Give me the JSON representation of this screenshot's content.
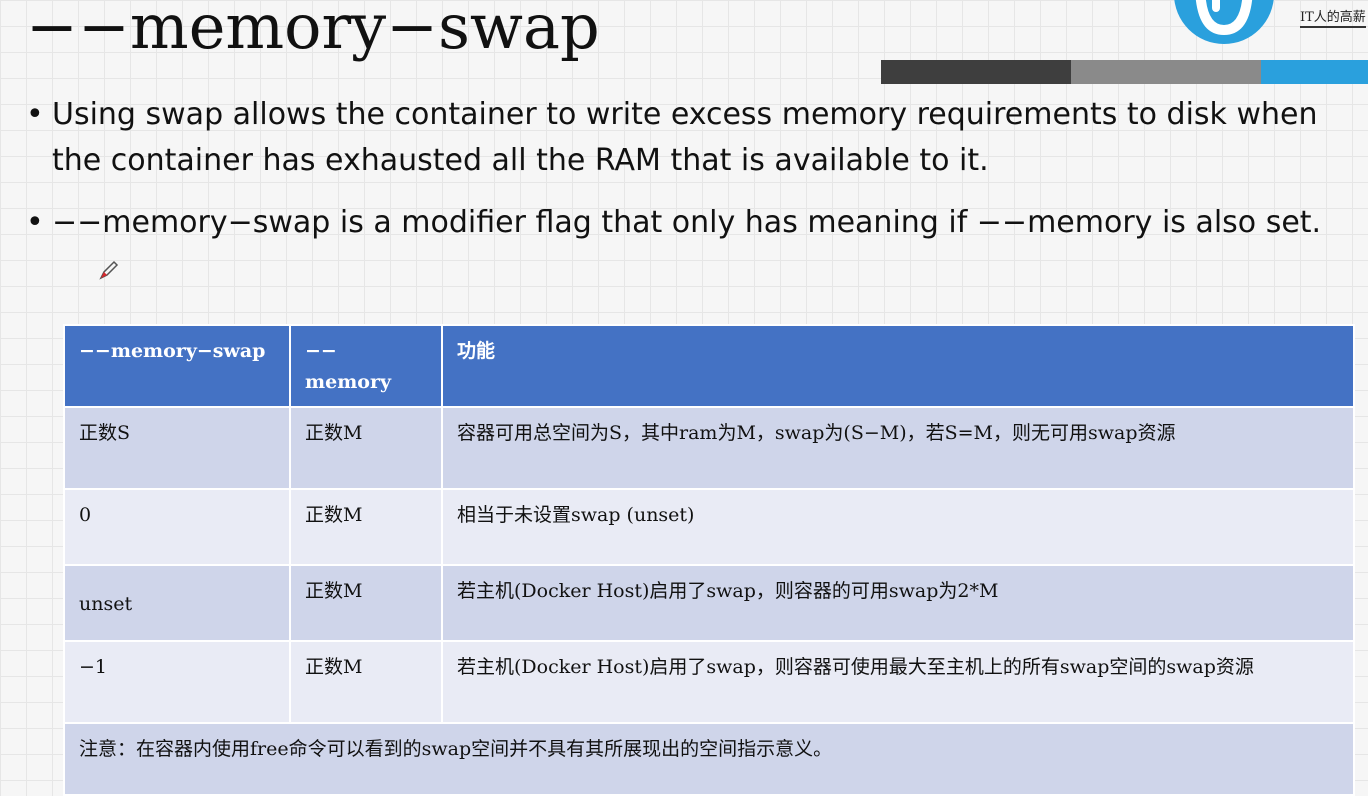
{
  "slide": {
    "title": "−−memory−swap",
    "logo_text": "IT人的高薪",
    "bullets": [
      "Using swap allows the container to write excess memory requirements to disk when the container has exhausted all the RAM that is available to it.",
      "−−memory−swap is a modifier flag that only has meaning if −−memory is also set."
    ],
    "colors": {
      "header_blue": "#4472c4",
      "row_dark": "#cfd5ea",
      "row_light": "#e9ebf5",
      "band_dark": "#3e3e3e",
      "band_gray": "#8a8a8a",
      "band_blue": "#2aa0dd"
    }
  },
  "table": {
    "headers": [
      "−−memory−swap",
      "−−\nmemory",
      "功能"
    ],
    "rows": [
      [
        "正数S",
        "正数M",
        "容器可用总空间为S，其中ram为M，swap为(S−M)，若S=M，则无可用swap资源"
      ],
      [
        "0",
        "正数M",
        "相当于未设置swap (unset)"
      ],
      [
        "unset",
        "正数M",
        "若主机(Docker Host)启用了swap，则容器的可用swap为2*M"
      ],
      [
        "−1",
        "正数M",
        "若主机(Docker Host)启用了swap，则容器可使用最大至主机上的所有swap空间的swap资源"
      ]
    ],
    "note": "注意：在容器内使用free命令可以看到的swap空间并不具有其所展现出的空间指示意义。"
  }
}
